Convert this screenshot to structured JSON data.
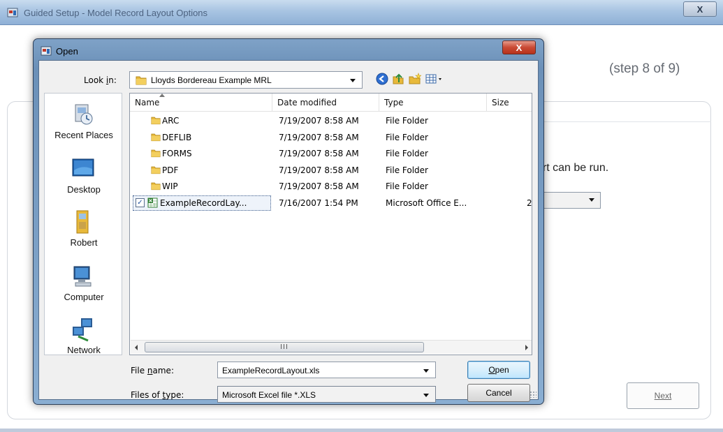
{
  "background_window": {
    "title": "Guided Setup - Model Record Layout Options",
    "close_label": "X",
    "step_text": "(step 8 of 9)",
    "partial_text": "ort can be run.",
    "next_label": "Next"
  },
  "dialog": {
    "title": "Open",
    "close_label": "X",
    "look_in_label": "Look in:",
    "look_in_value": "Lloyds Bordereau Example MRL",
    "toolbar_icons": [
      "back-icon",
      "up-folder-icon",
      "new-folder-icon",
      "views-menu-icon"
    ],
    "places": [
      {
        "label": "Recent Places",
        "icon": "recent-places-icon"
      },
      {
        "label": "Desktop",
        "icon": "desktop-icon"
      },
      {
        "label": "Robert",
        "icon": "user-folder-icon"
      },
      {
        "label": "Computer",
        "icon": "computer-icon"
      },
      {
        "label": "Network",
        "icon": "network-icon"
      }
    ],
    "columns": [
      "Name",
      "Date modified",
      "Type",
      "Size"
    ],
    "files": [
      {
        "name": "ARC",
        "date": "7/19/2007 8:58 AM",
        "type": "File Folder",
        "size": "",
        "icon": "folder-icon"
      },
      {
        "name": "DEFLIB",
        "date": "7/19/2007 8:58 AM",
        "type": "File Folder",
        "size": "",
        "icon": "folder-icon"
      },
      {
        "name": "FORMS",
        "date": "7/19/2007 8:58 AM",
        "type": "File Folder",
        "size": "",
        "icon": "folder-icon"
      },
      {
        "name": "PDF",
        "date": "7/19/2007 8:58 AM",
        "type": "File Folder",
        "size": "",
        "icon": "folder-icon"
      },
      {
        "name": "WIP",
        "date": "7/19/2007 8:58 AM",
        "type": "File Folder",
        "size": "",
        "icon": "folder-icon"
      },
      {
        "name": "ExampleRecordLay...",
        "date": "7/16/2007 1:54 PM",
        "type": "Microsoft Office E...",
        "size": "2",
        "icon": "excel-file-icon",
        "selected": true
      }
    ],
    "scroll_grip": "III",
    "file_name_label": "File name:",
    "file_name_value": "ExampleRecordLayout.xls",
    "file_type_label": "Files of type:",
    "file_type_value": "Microsoft Excel file *.XLS",
    "open_label": "Open",
    "cancel_label": "Cancel"
  },
  "colors": {
    "dialog_frame": "#7fa2c7",
    "close_red": "#c94a34",
    "folder_yellow": "#e8b93a",
    "excel_green": "#2f7d32"
  }
}
